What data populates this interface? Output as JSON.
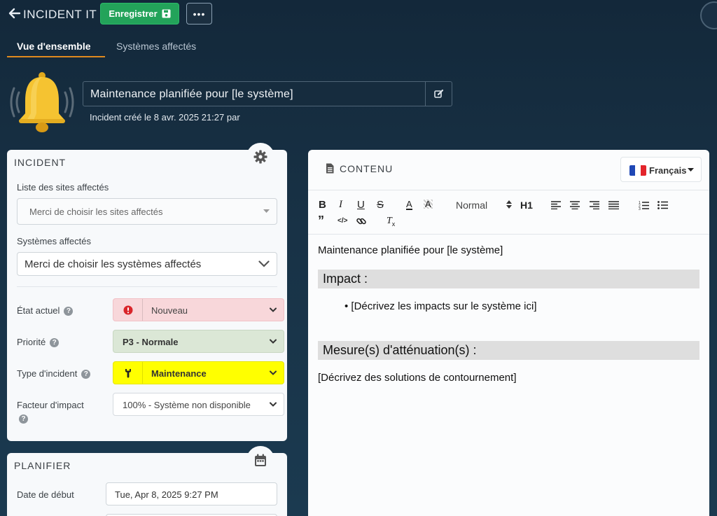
{
  "header": {
    "title": "INCIDENT IT",
    "save_label": "Enregistrer",
    "more_label": "•••"
  },
  "tabs": [
    {
      "label": "Vue d'ensemble",
      "active": true
    },
    {
      "label": "Systèmes affectés",
      "active": false
    }
  ],
  "incident_header": {
    "title": "Maintenance planifiée pour [le système]",
    "created": "Incident créé le 8 avr. 2025 21:27 par"
  },
  "incident_card": {
    "title": "INCIDENT",
    "sites_label": "Liste des sites affectés",
    "sites_placeholder": "Merci de choisir les sites affectés",
    "systems_label": "Systèmes affectés",
    "systems_placeholder": "Merci de choisir les systèmes affectés",
    "state_label": "État actuel",
    "state_value": "Nouveau",
    "priority_label": "Priorité",
    "priority_value": "P3 - Normale",
    "type_label": "Type d'incident",
    "type_value": "Maintenance",
    "impact_label": "Facteur d'impact",
    "impact_value": "100% - Système non disponible"
  },
  "plan_card": {
    "title": "PLANIFIER",
    "start_label": "Date de début",
    "start_value": "Tue, Apr 8, 2025 9:27 PM"
  },
  "content_card": {
    "title": "CONTENU",
    "language": "Français",
    "toolbar": {
      "heading_select": "Normal",
      "h1": "H1"
    },
    "editor": {
      "line1": "Maintenance planifiée pour [le système]",
      "heading1": "Impact :",
      "bullet1": "• [Décrivez les impacts sur le système ici]",
      "heading2": "Mesure(s) d'atténuation(s) :",
      "line2": "[Décrivez des solutions de contournement]"
    }
  },
  "colors": {
    "save_green": "#23a35a",
    "tab_accent": "#e08a1e",
    "state_bg": "#f8d7da",
    "priority_bg": "#dbe7d6",
    "type_bg": "#ffff00",
    "bell": "#f2c12e"
  }
}
